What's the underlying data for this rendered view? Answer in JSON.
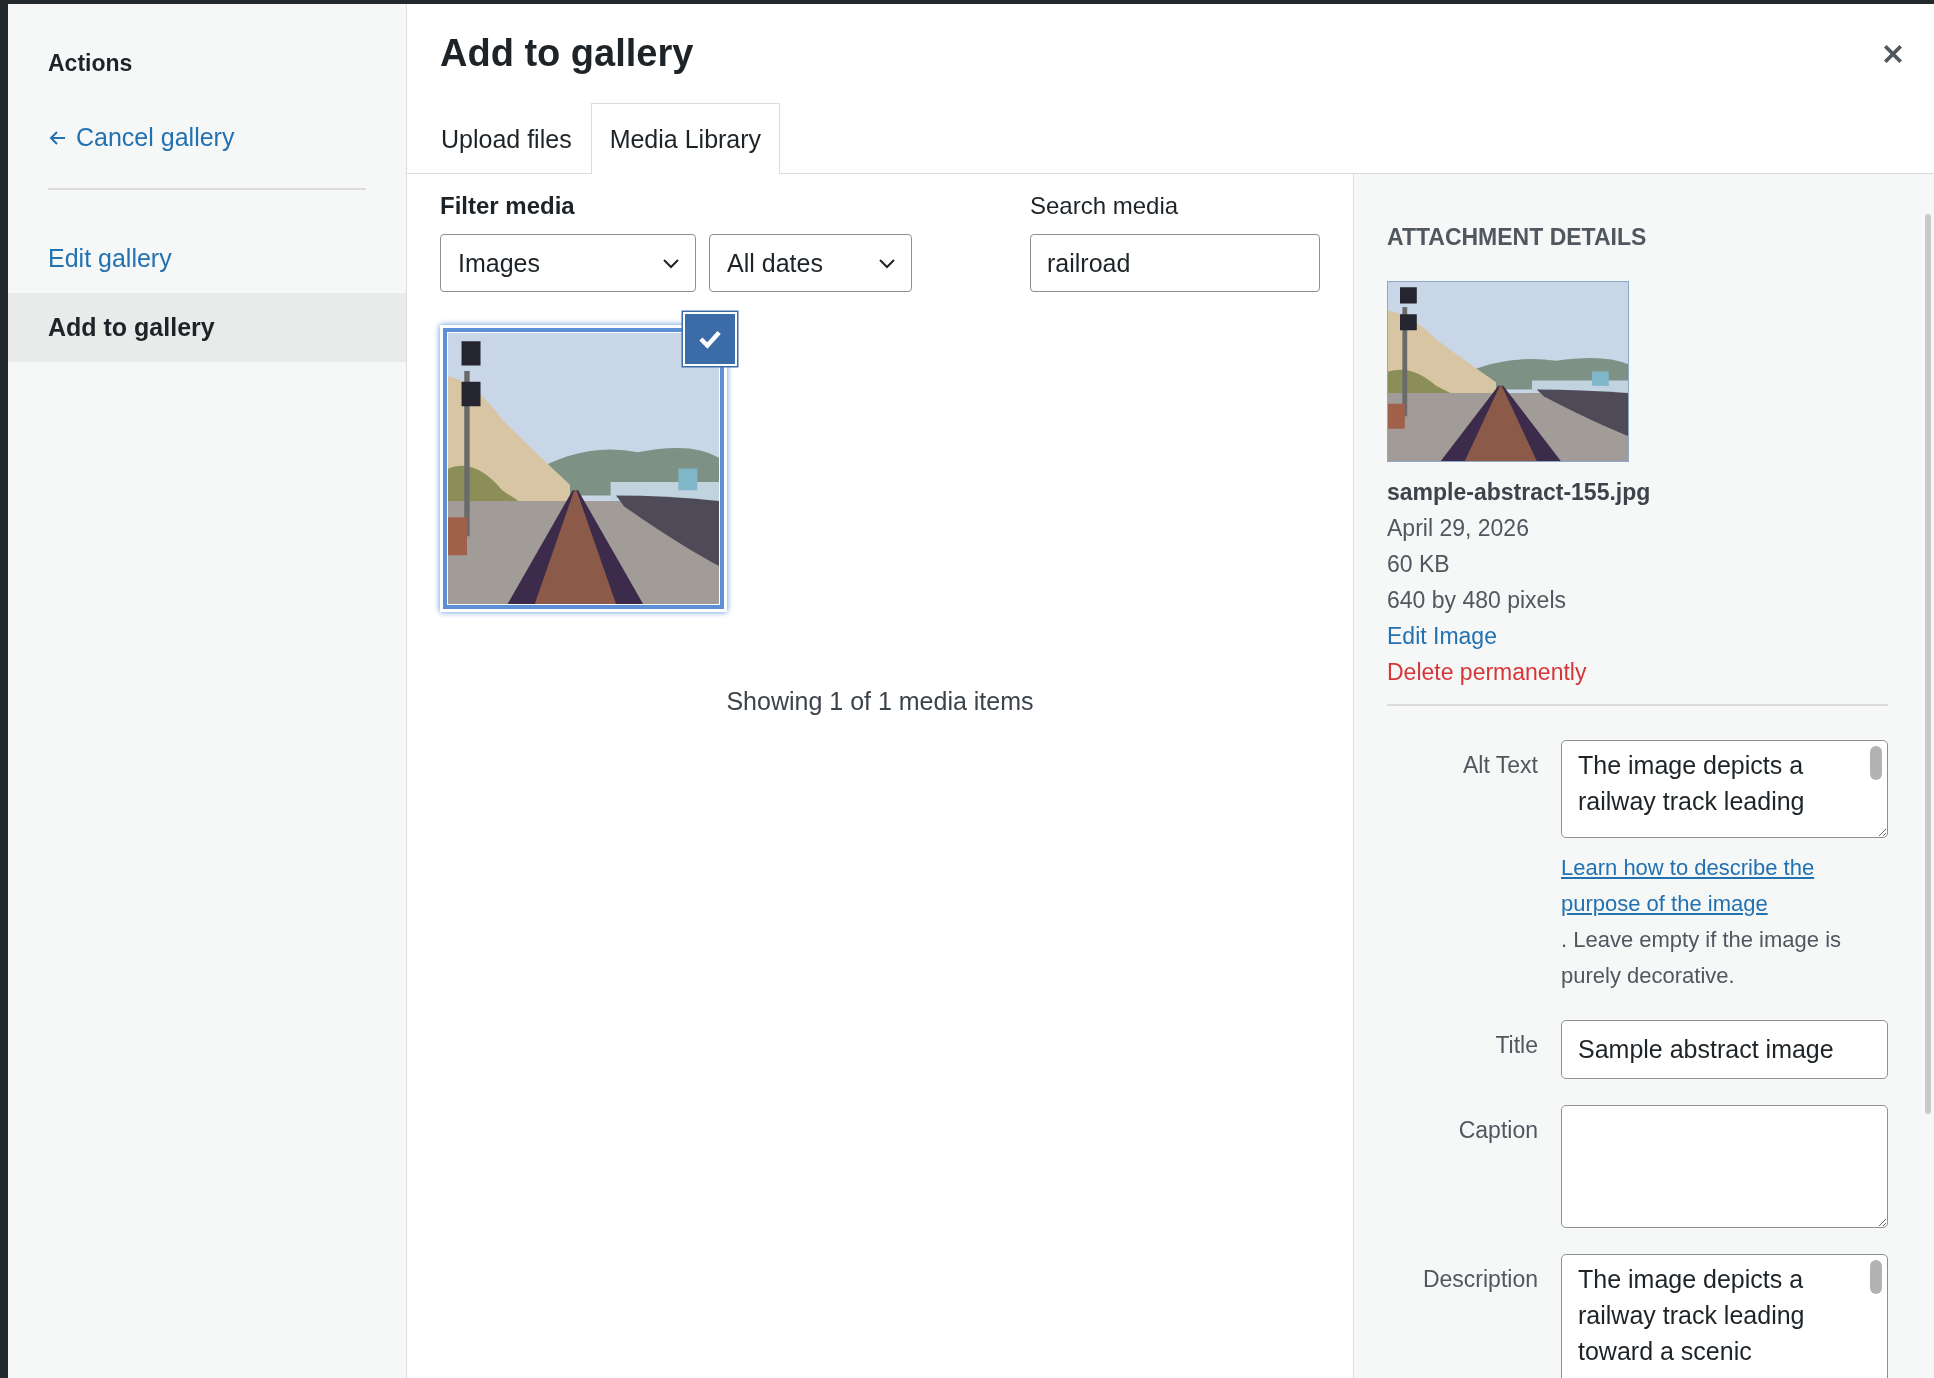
{
  "sidebar": {
    "heading": "Actions",
    "back_link": {
      "label": "Cancel gallery"
    },
    "items": [
      {
        "label": "Edit gallery",
        "selected": false
      },
      {
        "label": "Add to gallery",
        "selected": true
      }
    ]
  },
  "title": "Add to gallery",
  "tabs": [
    {
      "label": "Upload files",
      "selected": false
    },
    {
      "label": "Media Library",
      "selected": true
    }
  ],
  "filter": {
    "label": "Filter media",
    "selects": [
      {
        "value": "Images"
      },
      {
        "value": "All dates"
      }
    ]
  },
  "search": {
    "label": "Search media",
    "value": "railroad"
  },
  "attachments": [
    {
      "kind": "picture",
      "selected": true
    }
  ],
  "status": "Showing 1 of 1 media items",
  "details": {
    "heading": "ATTACHMENT DETAILS",
    "filename": "sample-abstract-155.jpg",
    "date": "April 29, 2026",
    "size": "60 KB",
    "dimensions": "640 by 480 pixels",
    "edit_link": "Edit Image",
    "delete_link": "Delete permanently",
    "fields": [
      {
        "label": "Alt Text",
        "kind": "textarea",
        "value": "The image depicts a railway track leading",
        "help_link": "Learn how to describe the purpose of the image",
        "help_text": ". Leave empty if the image is purely decorative."
      },
      {
        "label": "Title",
        "kind": "input",
        "value": "Sample abstract image"
      },
      {
        "label": "Caption",
        "kind": "textarea"
      },
      {
        "label": "Description",
        "kind": "textarea",
        "value": "The image depicts a railway track leading toward a scenic"
      }
    ]
  }
}
